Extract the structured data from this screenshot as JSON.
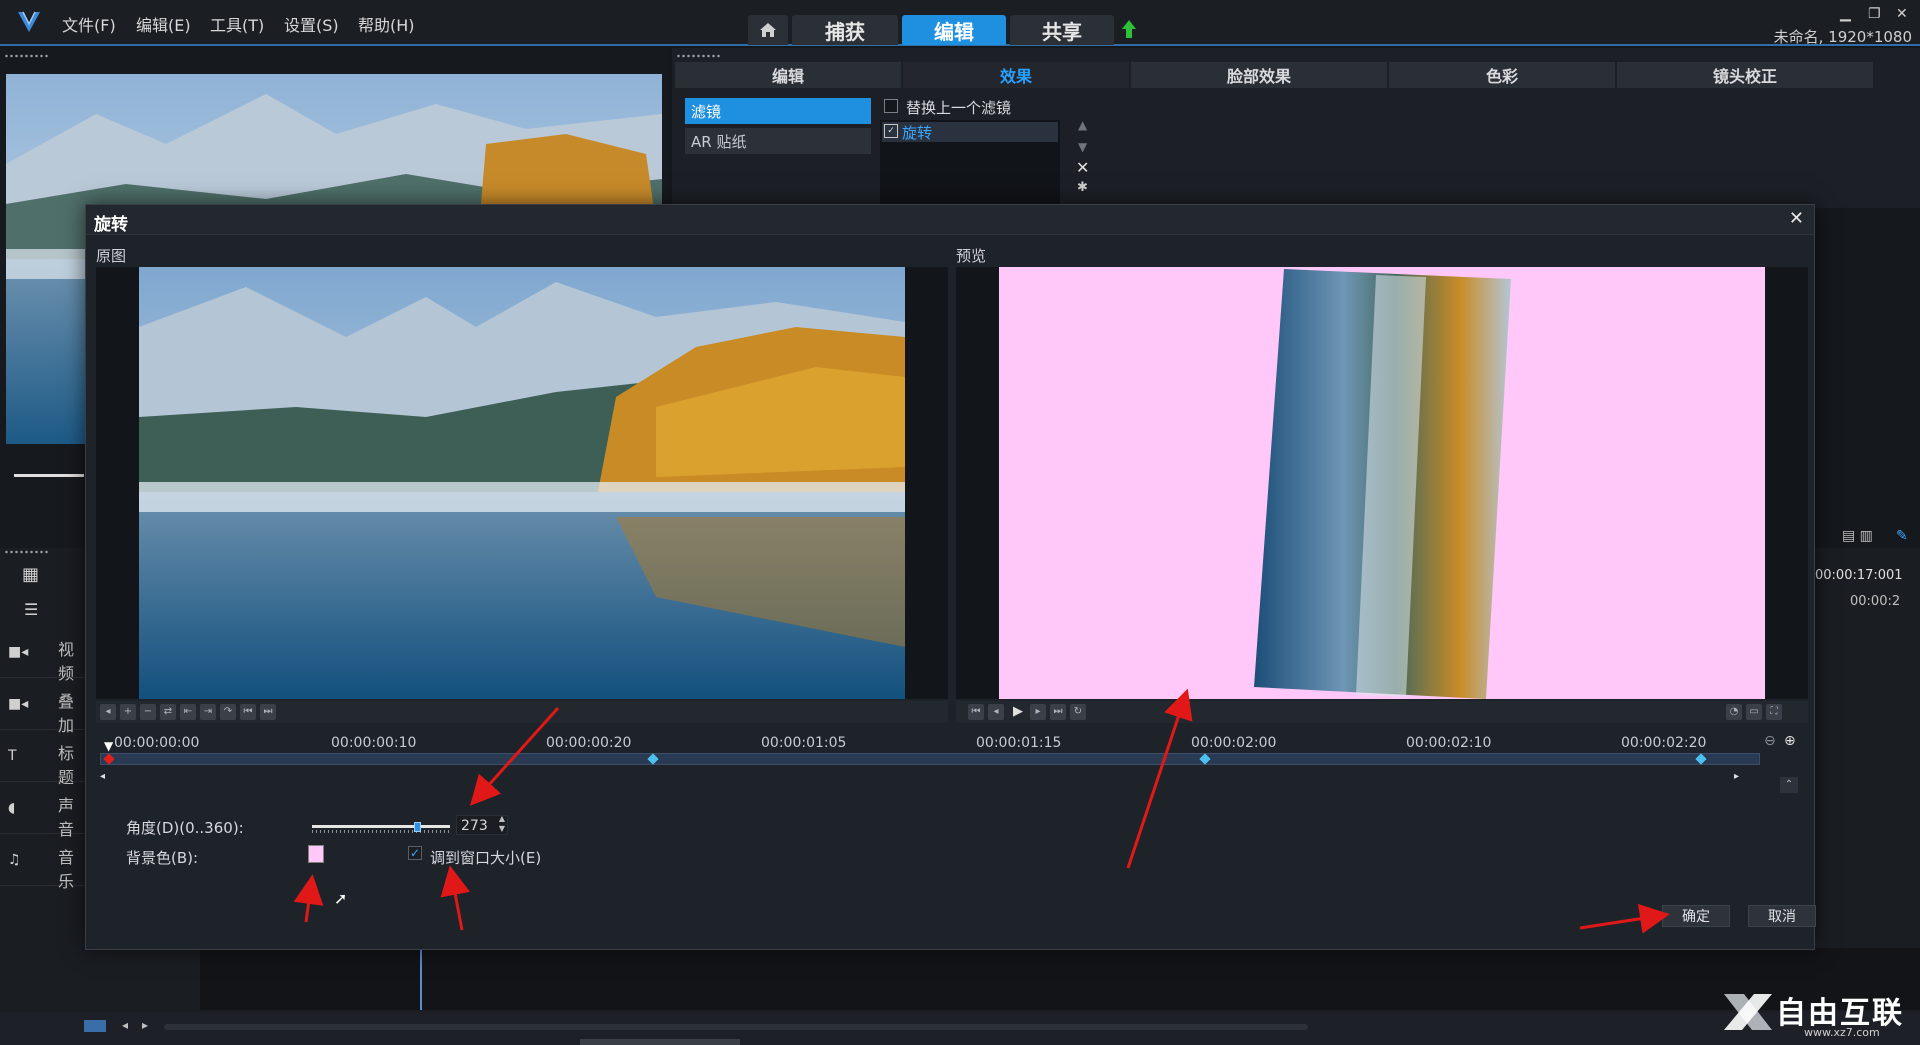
{
  "menu": {
    "items": [
      "文件(F)",
      "编辑(E)",
      "工具(T)",
      "设置(S)",
      "帮助(H)"
    ]
  },
  "modes": {
    "home_icon": "home-icon",
    "capture": "捕获",
    "edit": "编辑",
    "share": "共享"
  },
  "project": {
    "name": "未命名, 1920*1080"
  },
  "effects_panel": {
    "tabs": [
      "编辑",
      "效果",
      "脸部效果",
      "色彩",
      "镜头校正"
    ],
    "active_tab": "效果",
    "categories": [
      "滤镜",
      "AR 贴纸"
    ],
    "replace_filter_label": "替换上一个滤镜",
    "applied_filter": "旋转"
  },
  "timeline": {
    "tracks": [
      "视频",
      "叠加",
      "标题",
      "声音",
      "音乐"
    ],
    "timecode": "00:00:17:001",
    "ruler_time": "00:00:2"
  },
  "dialog": {
    "title": "旋转",
    "original_label": "原图",
    "preview_label": "预览",
    "ruler": [
      "00:00:00:00",
      "00:00:00:10",
      "00:00:00:20",
      "00:00:01:05",
      "00:00:01:15",
      "00:00:02:00",
      "00:00:02:10",
      "00:00:02:20"
    ],
    "angle_label": "角度(D)(0..360):",
    "angle_value": "273",
    "angle_fraction": 0.758,
    "bgcolor_label": "背景色(B):",
    "bgcolor": "#ffc8f8",
    "fit_window_label": "调到窗口大小(E)",
    "fit_window_checked": true,
    "ok": "确定",
    "cancel": "取消"
  },
  "watermark": {
    "text": "自由互联",
    "url": "www.xz7.com"
  },
  "colors": {
    "accent": "#1f8fe0",
    "annotation_arrow": "#e01818"
  }
}
